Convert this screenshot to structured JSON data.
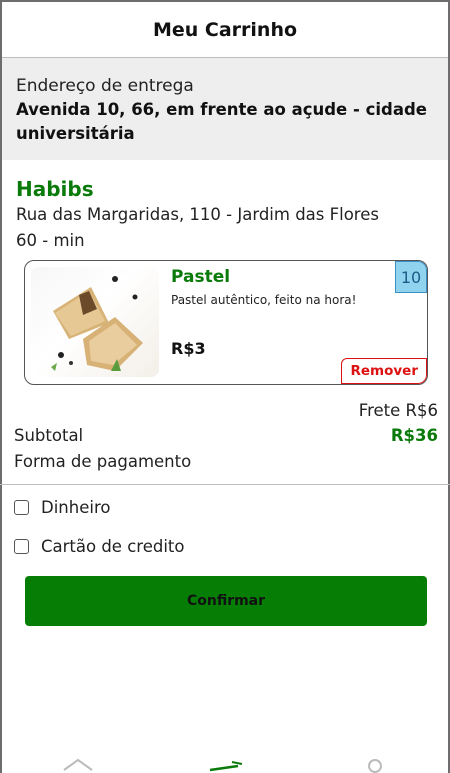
{
  "header": {
    "title": "Meu Carrinho"
  },
  "address": {
    "label": "Endereço de entrega",
    "value": "Avenida 10, 66, em frente ao açude - cidade universitária"
  },
  "store": {
    "name": "Habibs",
    "address": "Rua das Margaridas, 110 - Jardim das Flores",
    "time": "60 - min"
  },
  "cart_item": {
    "title": "Pastel",
    "description": "Pastel autêntico, feito na hora!",
    "price": "R$3",
    "quantity": "10",
    "remove_label": "Remover"
  },
  "summary": {
    "frete": "Frete R$6",
    "subtotal_label": "Subtotal",
    "subtotal_value": "R$36",
    "payment_label": "Forma de pagamento"
  },
  "payment_options": [
    {
      "label": "Dinheiro",
      "checked": false
    },
    {
      "label": "Cartão de credito",
      "checked": false
    }
  ],
  "confirm_label": "Confirmar",
  "colors": {
    "accent_green": "#0a7a0a",
    "button_green": "#067e06",
    "remove_red": "#dd1111"
  },
  "bottom_nav": {
    "icons": [
      "home-icon",
      "cart-icon",
      "profile-icon"
    ]
  }
}
